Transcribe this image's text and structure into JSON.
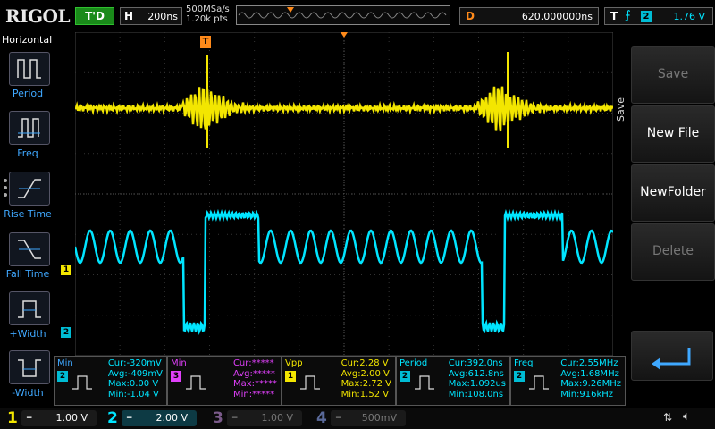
{
  "top": {
    "logo": "RIGOL",
    "trigger_state": "T'D",
    "horizontal_key": "H",
    "timebase": "200ns",
    "sample_rate": "500MSa/s",
    "mem_depth": "1.20k pts",
    "delay_key": "D",
    "delay_value": "620.000000ns",
    "trigger_key": "T",
    "trigger_source": "2",
    "trigger_level": "1.76 V"
  },
  "left_menu": {
    "title": "Horizontal",
    "items": [
      {
        "label": "Period",
        "icon": "period-icon"
      },
      {
        "label": "Freq",
        "icon": "frequency-icon"
      },
      {
        "label": "Rise Time",
        "icon": "rise-time-icon"
      },
      {
        "label": "Fall Time",
        "icon": "fall-time-icon"
      },
      {
        "label": "+Width",
        "icon": "positive-width-icon"
      },
      {
        "label": "-Width",
        "icon": "negative-width-icon"
      }
    ]
  },
  "right_menu": {
    "side_label": "Save",
    "buttons": [
      {
        "label": "Save",
        "enabled": false
      },
      {
        "label": "New File",
        "enabled": true
      },
      {
        "label": "NewFolder",
        "enabled": true
      },
      {
        "label": "Delete",
        "enabled": false
      }
    ],
    "back_icon": "return-arrow-icon"
  },
  "markers": {
    "trigger_pos": "T",
    "ch1_marker": "1",
    "ch2_marker": "2",
    "trig_level_marker": "T"
  },
  "measurements": [
    {
      "name": "Min",
      "channel": "2",
      "chan_color": "#00bcd4",
      "name_color": "#3fa8ff",
      "icon": "min-icon",
      "lines": [
        "Cur:-320mV",
        "Avg:-409mV",
        "Max:0.00 V",
        "Min:-1.04 V"
      ],
      "value_color": "#00e5ff"
    },
    {
      "name": "Min",
      "channel": "3",
      "chan_color": "#e040fb",
      "name_color": "#e040fb",
      "icon": "min-icon",
      "lines": [
        "Cur:*****",
        "Avg:*****",
        "Max:*****",
        "Min:*****"
      ],
      "value_color": "#e040fb"
    },
    {
      "name": "Vpp",
      "channel": "1",
      "chan_color": "#f3e600",
      "name_color": "#f3e600",
      "icon": "vpp-icon",
      "lines": [
        "Cur:2.28 V",
        "Avg:2.00 V",
        "Max:2.72 V",
        "Min:1.52 V"
      ],
      "value_color": "#f3e600"
    },
    {
      "name": "Period",
      "channel": "2",
      "chan_color": "#00bcd4",
      "name_color": "#00e5ff",
      "icon": "period-icon",
      "lines": [
        "Cur:392.0ns",
        "Avg:612.8ns",
        "Max:1.092us",
        "Min:108.0ns"
      ],
      "value_color": "#00e5ff"
    },
    {
      "name": "Freq",
      "channel": "2",
      "chan_color": "#00bcd4",
      "name_color": "#00e5ff",
      "icon": "frequency-icon",
      "lines": [
        "Cur:2.55MHz",
        "Avg:1.68MHz",
        "Max:9.26MHz",
        "Min:916kHz"
      ],
      "value_color": "#00e5ff"
    }
  ],
  "channels": [
    {
      "num": "1",
      "scale": "1.00 V",
      "color": "#f3e600",
      "active": true
    },
    {
      "num": "2",
      "scale": "2.00 V",
      "color": "#00e5ff",
      "active": true
    },
    {
      "num": "3",
      "scale": "1.00 V",
      "color": "#7a5a8a",
      "active": false
    },
    {
      "num": "4",
      "scale": "500mV",
      "color": "#5a6a9a",
      "active": false
    }
  ],
  "status_icons": [
    "usb-icon",
    "speaker-mute-icon"
  ],
  "colors": {
    "ch1": "#f3e600",
    "ch2": "#00e5ff",
    "accent": "#ff8a1a"
  }
}
